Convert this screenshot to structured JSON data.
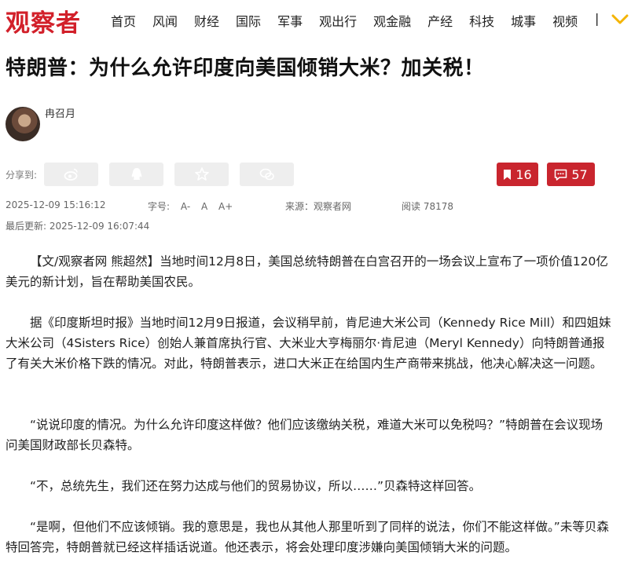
{
  "site": {
    "logo_text": "观察者"
  },
  "nav": {
    "items": [
      "首页",
      "风闻",
      "财经",
      "国际",
      "军事",
      "观出行",
      "观金融",
      "产经",
      "科技",
      "城事",
      "视频"
    ],
    "separator": "|"
  },
  "article": {
    "title": "特朗普：为什么允许印度向美国倾销大米？加关税！",
    "author": "冉召月",
    "share_label": "分享到:",
    "bookmark_count": "16",
    "comment_count": "57",
    "publish_time": "2025-12-09 15:16:12",
    "font_size_label": "字号:",
    "font_small": "A-",
    "font_normal": "A",
    "font_large": "A+",
    "source": "来源：观察者网",
    "views": "阅读 78178",
    "last_updated": "最后更新: 2025-12-09 16:07:44",
    "paragraphs": [
      "【文/观察者网 熊超然】当地时间12月8日，美国总统特朗普在白宫召开的一场会议上宣布了一项价值120亿美元的新计划，旨在帮助美国农民。",
      "据《印度斯坦时报》当地时间12月9日报道，会议稍早前，肯尼迪大米公司（Kennedy Rice Mill）和四姐妹大米公司（4Sisters Rice）创始人兼首席执行官、大米业大亨梅丽尔·肯尼迪（Meryl Kennedy）向特朗普通报了有关大米价格下跌的情况。对此，特朗普表示，进口大米正在给国内生产商带来挑战，他决心解决这一问题。",
      "“说说印度的情况。为什么允许印度这样做？他们应该缴纳关税，难道大米可以免税吗？”特朗普在会议现场问美国财政部长贝森特。",
      "“不，总统先生，我们还在努力达成与他们的贸易协议，所以……”贝森特这样回答。",
      "“是啊，但他们不应该倾销。我的意思是，我也从其他人那里听到了同样的说法，你们不能这样做。”未等贝森特回答完，特朗普就已经这样插话说道。他还表示，将会处理印度涉嫌向美国倾销大米的问题。"
    ]
  },
  "icons": [
    "weibo-icon",
    "qq-icon",
    "qzone-star-icon",
    "wechat-icon",
    "bookmark-icon",
    "comment-icon",
    "chevron-down-icon"
  ],
  "colors": {
    "brand_red": "#d2202a",
    "button_red": "#c9252e",
    "share_gray": "#eeeeee",
    "chevron_yellow": "#f4b400"
  }
}
